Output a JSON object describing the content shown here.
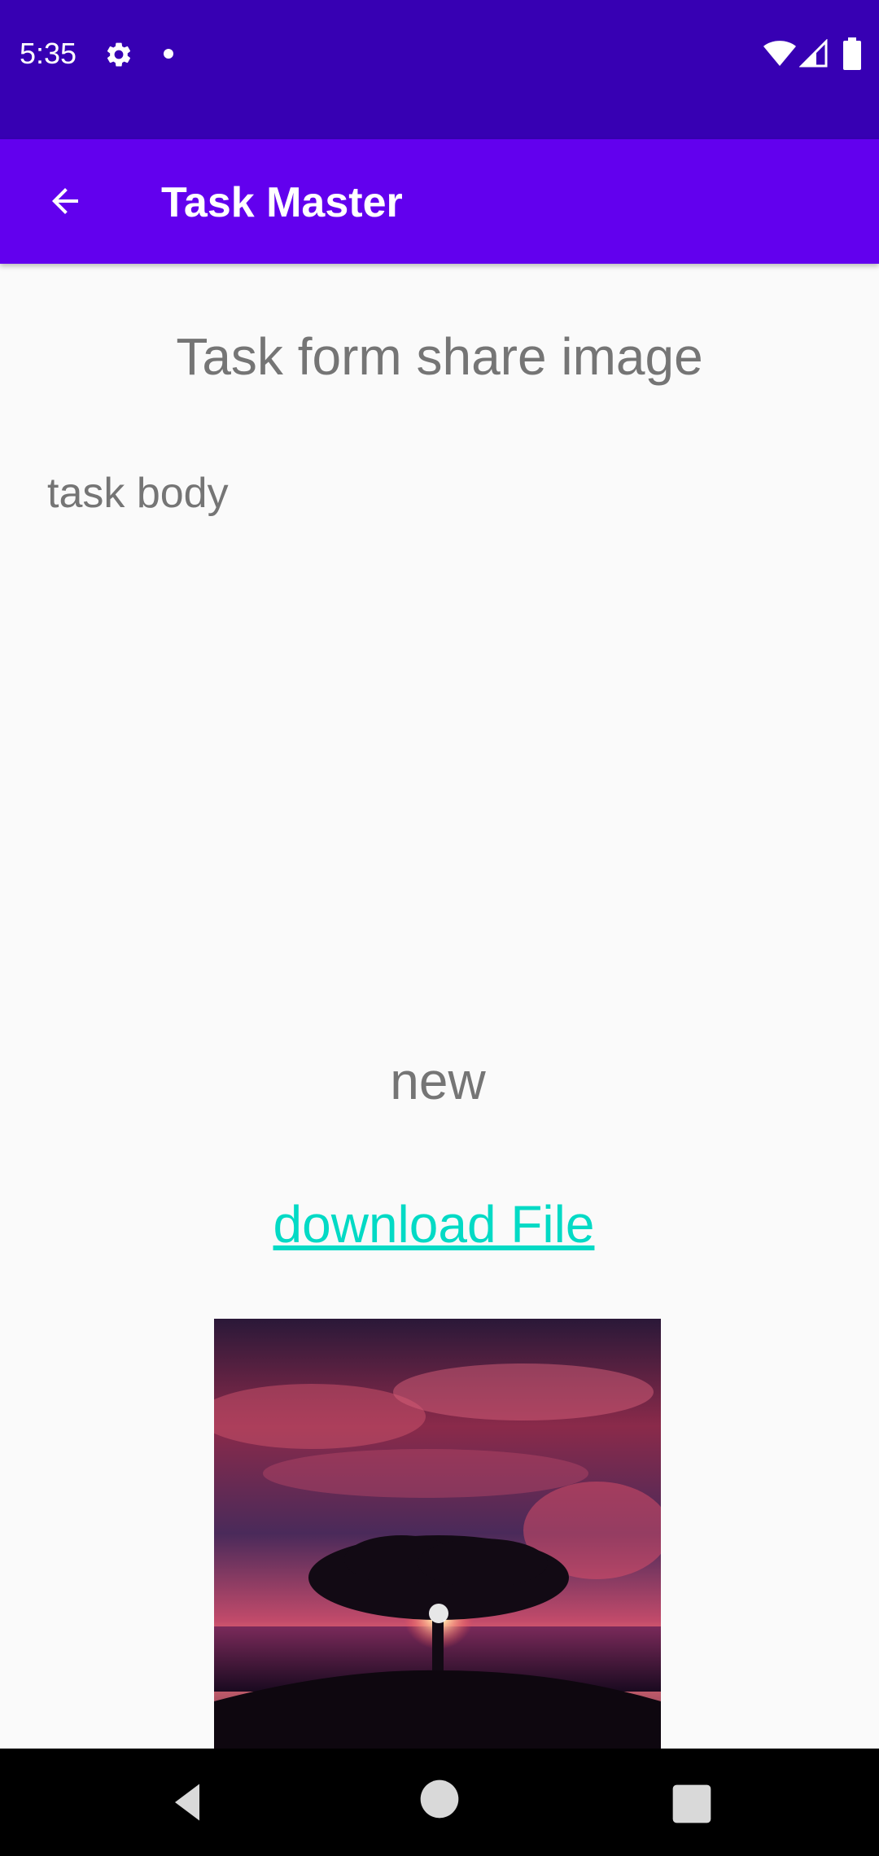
{
  "status_bar": {
    "time": "5:35",
    "icons": [
      "gear-icon",
      "notification-dot-icon",
      "wifi-icon",
      "cell-signal-icon",
      "battery-icon"
    ],
    "background": "#3700b3"
  },
  "app_bar": {
    "title": "Task Master",
    "back_icon": "arrow-left-icon",
    "background": "#6200ee"
  },
  "task": {
    "title": "Task form share image",
    "body": "task body",
    "state": "new",
    "download_link": "download File",
    "link_color": "#03dac5"
  },
  "nav_bar": {
    "icons": [
      "back-triangle-icon",
      "home-circle-icon",
      "recents-square-icon"
    ]
  }
}
